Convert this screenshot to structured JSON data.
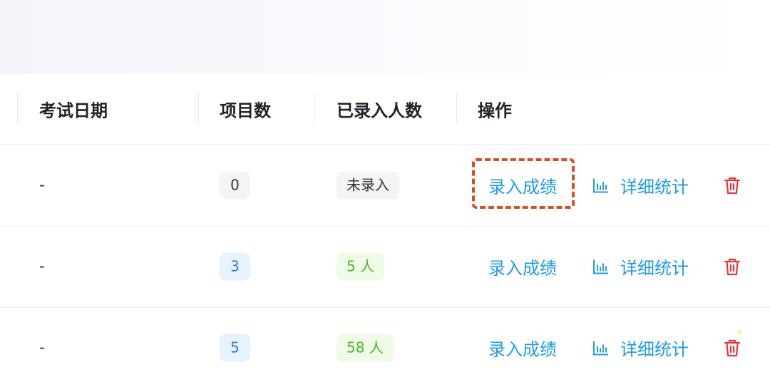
{
  "table": {
    "columns": {
      "exam_date": "考试日期",
      "item_count": "项目数",
      "entered_count": "已录入人数",
      "actions": "操作"
    },
    "rows": [
      {
        "exam_date": "-",
        "item_count": "0",
        "entered": "未录入",
        "actions": {
          "enter_scores": "录入成绩",
          "detail_stats": "详细统计"
        }
      },
      {
        "exam_date": "-",
        "item_count": "3",
        "entered": "5 人",
        "actions": {
          "enter_scores": "录入成绩",
          "detail_stats": "详细统计"
        }
      },
      {
        "exam_date": "-",
        "item_count": "5",
        "entered": "58 人",
        "actions": {
          "enter_scores": "录入成绩",
          "detail_stats": "详细统计"
        }
      }
    ]
  },
  "icons": {
    "stats": "bar-chart-icon",
    "delete": "trash-icon"
  },
  "colors": {
    "link": "#1e9be6",
    "delete": "#e0393e",
    "count_badge_bg": "#e6f2fe",
    "count_badge_text": "#2d7be6",
    "entered_tag_bg": "#eefbe6",
    "entered_tag_text": "#52b32c",
    "highlight_border": "#d2512a"
  }
}
